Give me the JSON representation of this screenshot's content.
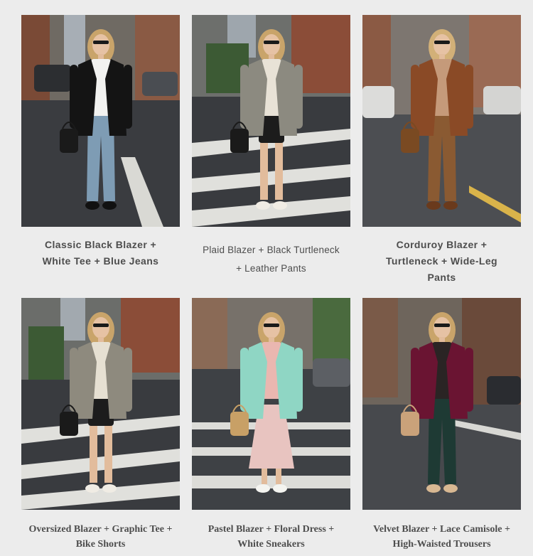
{
  "outfits": [
    {
      "caption_lines": [
        "Classic Black Blazer +",
        "White Tee + Blue Jeans"
      ],
      "colors": {
        "blazer": "#141414",
        "top": "#f2f2f0",
        "bottom": "#7e9cb4",
        "bag": "#1a1a1a",
        "hair": "#c9a46a",
        "shoes": "#111111"
      }
    },
    {
      "caption_lines": [
        "Plaid Blazer + Black Turtleneck",
        "+ Leather Pants"
      ],
      "colors": {
        "blazer": "#8c8a80",
        "top": "#e8e2d6",
        "bottom": "#1c1c1c",
        "bag": "#1a1a1a",
        "hair": "#c9a46a",
        "shoes": "#f0ece4"
      }
    },
    {
      "caption_lines": [
        "Corduroy Blazer +",
        "Turtleneck + Wide-Leg",
        "Pants"
      ],
      "colors": {
        "blazer": "#8a4a26",
        "top": "#c59a7a",
        "bottom": "#8a5a32",
        "bag": "#7a4a22",
        "hair": "#d2b078",
        "shoes": "#6a3a1c"
      }
    },
    {
      "caption_lines": [
        "Oversized Blazer + Graphic Tee +",
        "Bike Shorts"
      ],
      "colors": {
        "blazer": "#8e8a7e",
        "top": "#e6e0d2",
        "bottom": "#1c1c1c",
        "bag": "#1a1a1a",
        "hair": "#c9a46a",
        "shoes": "#f0ece4"
      }
    },
    {
      "caption_lines": [
        "Pastel Blazer + Floral Dress +",
        "White Sneakers"
      ],
      "colors": {
        "blazer": "#8fd6c4",
        "top": "#eab7b0",
        "bottom": "#e8c4c0",
        "bag": "#c8a066",
        "hair": "#c9a46a",
        "shoes": "#f4f4f0"
      }
    },
    {
      "caption_lines": [
        "Velvet Blazer + Lace Camisole +",
        "High-Waisted Trousers"
      ],
      "colors": {
        "blazer": "#6a1432",
        "top": "#2a2424",
        "bottom": "#1e3a34",
        "bag": "#caa27a",
        "hair": "#c9a46a",
        "shoes": "#d8b892"
      }
    }
  ]
}
